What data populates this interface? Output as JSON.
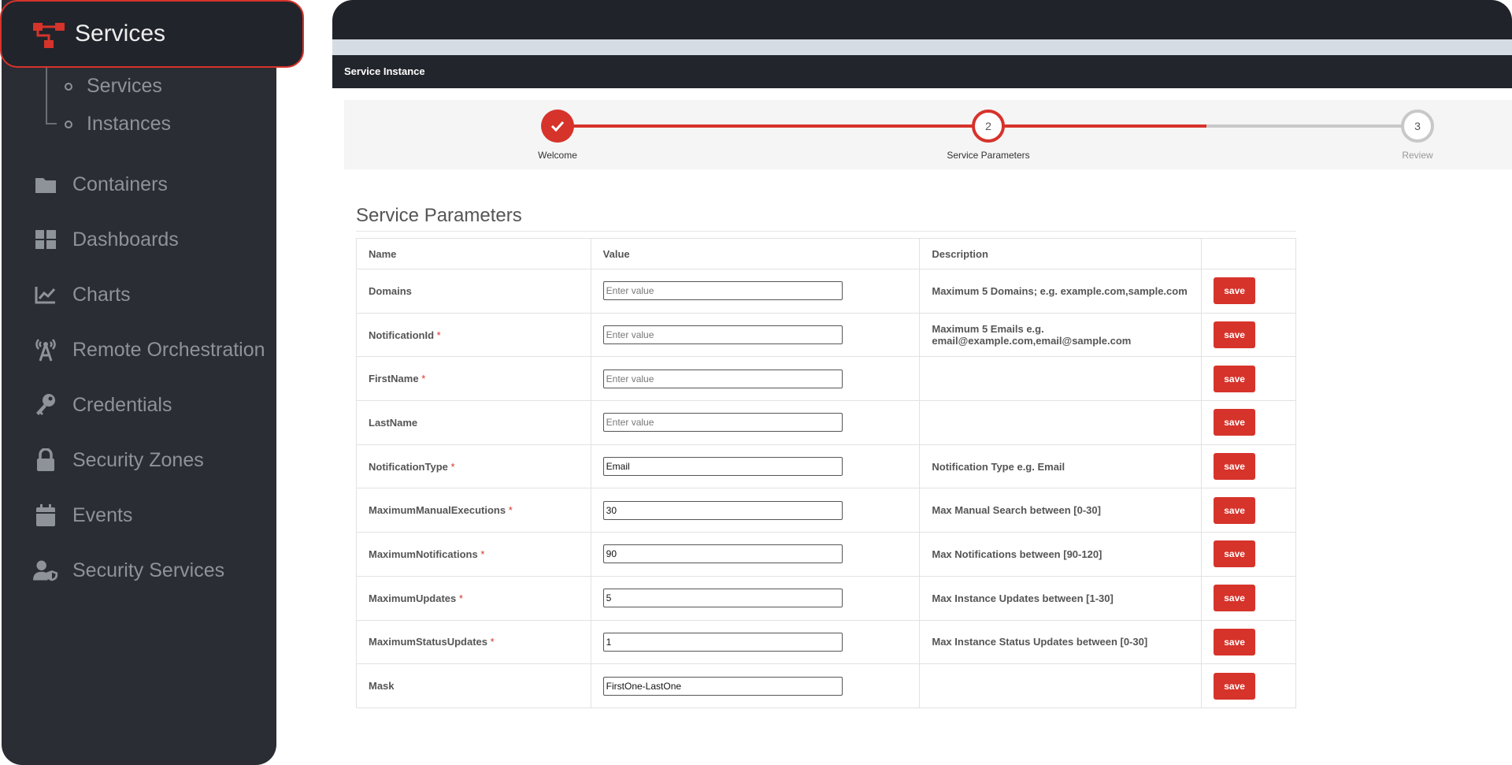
{
  "sidebar": {
    "header": {
      "label": "Services",
      "icon": "sitemap-icon"
    },
    "sub_items": [
      {
        "label": "Services"
      },
      {
        "label": "Instances"
      }
    ],
    "items": [
      {
        "label": "Containers",
        "icon": "folder-icon"
      },
      {
        "label": "Dashboards",
        "icon": "dashboard-grid-icon"
      },
      {
        "label": "Charts",
        "icon": "line-chart-icon"
      },
      {
        "label": "Remote Orchestration",
        "icon": "broadcast-tower-icon"
      },
      {
        "label": "Credentials",
        "icon": "key-icon"
      },
      {
        "label": "Security Zones",
        "icon": "lock-icon"
      },
      {
        "label": "Events",
        "icon": "calendar-icon"
      },
      {
        "label": "Security Services",
        "icon": "user-shield-icon"
      }
    ]
  },
  "panel": {
    "title": "Service Instance"
  },
  "stepper": {
    "steps": [
      {
        "label": "Welcome",
        "number": "",
        "state": "done"
      },
      {
        "label": "Service Parameters",
        "number": "2",
        "state": "active"
      },
      {
        "label": "Review",
        "number": "3",
        "state": "pending"
      }
    ]
  },
  "section": {
    "title": "Service Parameters"
  },
  "table": {
    "headers": {
      "name": "Name",
      "value": "Value",
      "description": "Description"
    },
    "placeholder": "Enter value",
    "save_label": "save",
    "rows": [
      {
        "name": "Domains",
        "required": "",
        "value": "",
        "description": "Maximum 5 Domains; e.g. example.com,sample.com"
      },
      {
        "name": "NotificationId",
        "required": "*",
        "value": "",
        "description": "Maximum 5 Emails e.g. email@example.com,email@sample.com"
      },
      {
        "name": "FirstName",
        "required": "*",
        "value": "",
        "description": ""
      },
      {
        "name": "LastName",
        "required": "",
        "value": "",
        "description": ""
      },
      {
        "name": "NotificationType",
        "required": "*",
        "value": "Email",
        "description": "Notification Type e.g. Email"
      },
      {
        "name": "MaximumManualExecutions",
        "required": "*",
        "value": "30",
        "description": "Max Manual Search between [0-30]"
      },
      {
        "name": "MaximumNotifications",
        "required": "*",
        "value": "90",
        "description": "Max Notifications between [90-120]"
      },
      {
        "name": "MaximumUpdates",
        "required": "*",
        "value": "5",
        "description": "Max Instance Updates between [1-30]"
      },
      {
        "name": "MaximumStatusUpdates",
        "required": "*",
        "value": "1",
        "description": "Max Instance Status Updates between [0-30]"
      },
      {
        "name": "Mask",
        "required": "",
        "value": "FirstOne-LastOne",
        "description": ""
      }
    ]
  },
  "colors": {
    "accent": "#d6332b",
    "sidebar_bg": "#2a2d33",
    "topbar_bg": "#20232a"
  }
}
